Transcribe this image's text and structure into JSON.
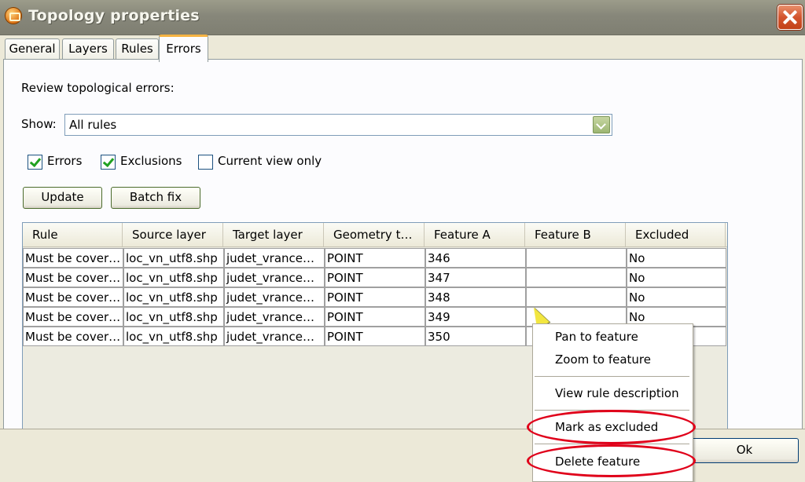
{
  "window": {
    "title": "Topology properties"
  },
  "tabs": [
    "General",
    "Layers",
    "Rules",
    "Errors"
  ],
  "errors_tab": {
    "heading": "Review topological errors:",
    "show_label": "Show:",
    "show_value": "All rules",
    "checkboxes": [
      {
        "label": "Errors",
        "checked": true
      },
      {
        "label": "Exclusions",
        "checked": true
      },
      {
        "label": "Current view only",
        "checked": false
      }
    ],
    "buttons": {
      "update": "Update",
      "batch_fix": "Batch fix"
    }
  },
  "table": {
    "columns": [
      "Rule",
      "Source layer",
      "Target layer",
      "Geometry t…",
      "Feature A",
      "Feature B",
      "Excluded"
    ],
    "rows": [
      [
        "Must be cover…",
        "loc_vn_utf8.shp",
        "judet_vrance…",
        "POINT",
        "346",
        "",
        "No"
      ],
      [
        "Must be cover…",
        "loc_vn_utf8.shp",
        "judet_vrance…",
        "POINT",
        "347",
        "",
        "No"
      ],
      [
        "Must be cover…",
        "loc_vn_utf8.shp",
        "judet_vrance…",
        "POINT",
        "348",
        "",
        "No"
      ],
      [
        "Must be cover…",
        "loc_vn_utf8.shp",
        "judet_vrance…",
        "POINT",
        "349",
        "",
        "No"
      ],
      [
        "Must be cover…",
        "loc_vn_utf8.shp",
        "judet_vrance…",
        "POINT",
        "350",
        "",
        ""
      ]
    ]
  },
  "context_menu": {
    "items": [
      "Pan to feature",
      "Zoom to feature",
      "View rule description",
      "Mark as excluded",
      "Delete feature"
    ]
  },
  "footer": {
    "ok": "Ok"
  },
  "colors": {
    "annotation_ring": "#e0001a",
    "active_tab_accent": "#f5b342"
  }
}
